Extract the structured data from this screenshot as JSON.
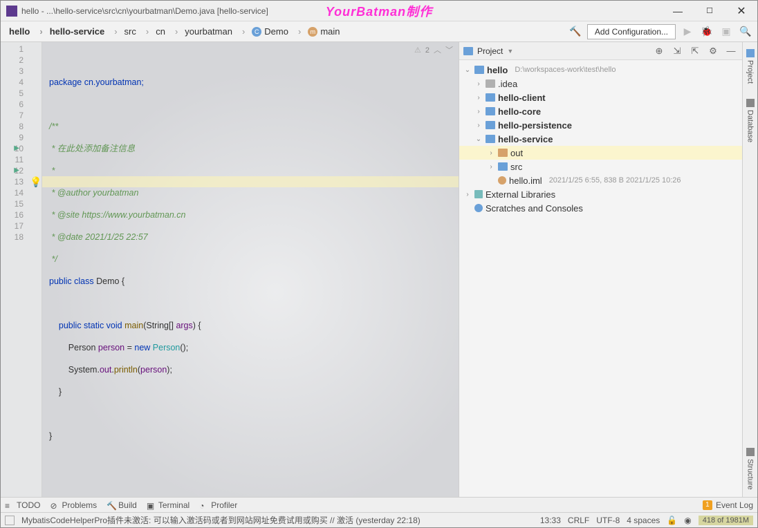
{
  "titlebar": {
    "title": "hello - ...\\hello-service\\src\\cn\\yourbatman\\Demo.java [hello-service]",
    "watermark": "YourBatman制作"
  },
  "breadcrumbs": [
    "hello",
    "hello-service",
    "src",
    "cn",
    "yourbatman",
    "Demo",
    "main"
  ],
  "navbar": {
    "add_config": "Add Configuration..."
  },
  "editor": {
    "inspection_text": "2",
    "bulb": "💡",
    "lines": {
      "l1": "package cn.yourbatman;",
      "l3": "/**",
      "l4": " * 在此处添加备注信息",
      "l5": " *",
      "l6": " * @author yourbatman",
      "l7": " * @site https://www.yourbatman.cn",
      "l8": " * @date 2021/1/25 22:57",
      "l9": " */",
      "l10a": "public class ",
      "l10b": "Demo",
      "l10c": " {",
      "l12a": "public static void ",
      "l12b": "main",
      "l12c": "(String[] ",
      "l12d": "args",
      "l12e": ") {",
      "l13a": "Person ",
      "l13b": "person",
      "l13c": " = ",
      "l13d": "new ",
      "l13e": "Person",
      "l13f": "();",
      "l14a": "System.",
      "l14b": "out",
      "l14c": ".",
      "l14d": "println",
      "l14e": "(",
      "l14f": "person",
      "l14g": ");",
      "l15": "}",
      "l17": "}"
    },
    "gutter_lines": [
      "1",
      "2",
      "3",
      "4",
      "5",
      "6",
      "7",
      "8",
      "9",
      "10",
      "11",
      "12",
      "13",
      "14",
      "15",
      "16",
      "17",
      "18"
    ]
  },
  "project": {
    "title": "Project",
    "root": {
      "name": "hello",
      "path": "D:\\workspaces-work\\test\\hello"
    },
    "items": [
      {
        "label": ".idea",
        "depth": 1,
        "bold": false
      },
      {
        "label": "hello-client",
        "depth": 1,
        "bold": true
      },
      {
        "label": "hello-core",
        "depth": 1,
        "bold": true
      },
      {
        "label": "hello-persistence",
        "depth": 1,
        "bold": true
      },
      {
        "label": "hello-service",
        "depth": 1,
        "bold": true
      },
      {
        "label": "out",
        "depth": 2,
        "bold": false,
        "sel": true
      },
      {
        "label": "src",
        "depth": 2,
        "bold": false
      },
      {
        "label": "hello.iml",
        "depth": 2,
        "bold": false,
        "meta": "2021/1/25 6:55, 838 B 2021/1/25 10:26"
      }
    ],
    "ext_lib": "External Libraries",
    "scratch": "Scratches and Consoles"
  },
  "toolstrip": {
    "project": "Project",
    "database": "Database",
    "structure": "Structure"
  },
  "bottom": {
    "todo": "TODO",
    "problems": "Problems",
    "build": "Build",
    "terminal": "Terminal",
    "profiler": "Profiler",
    "event_log": "Event Log",
    "event_badge": "1"
  },
  "status": {
    "msg": "MybatisCodeHelperPro插件未激活: 可以输入激活码或者到网站网址免费试用或购买 // 激活 (yesterday 22:18)",
    "cursor": "13:33",
    "eol": "CRLF",
    "enc": "UTF-8",
    "indent": "4 spaces",
    "mem": "418 of 1981M"
  }
}
